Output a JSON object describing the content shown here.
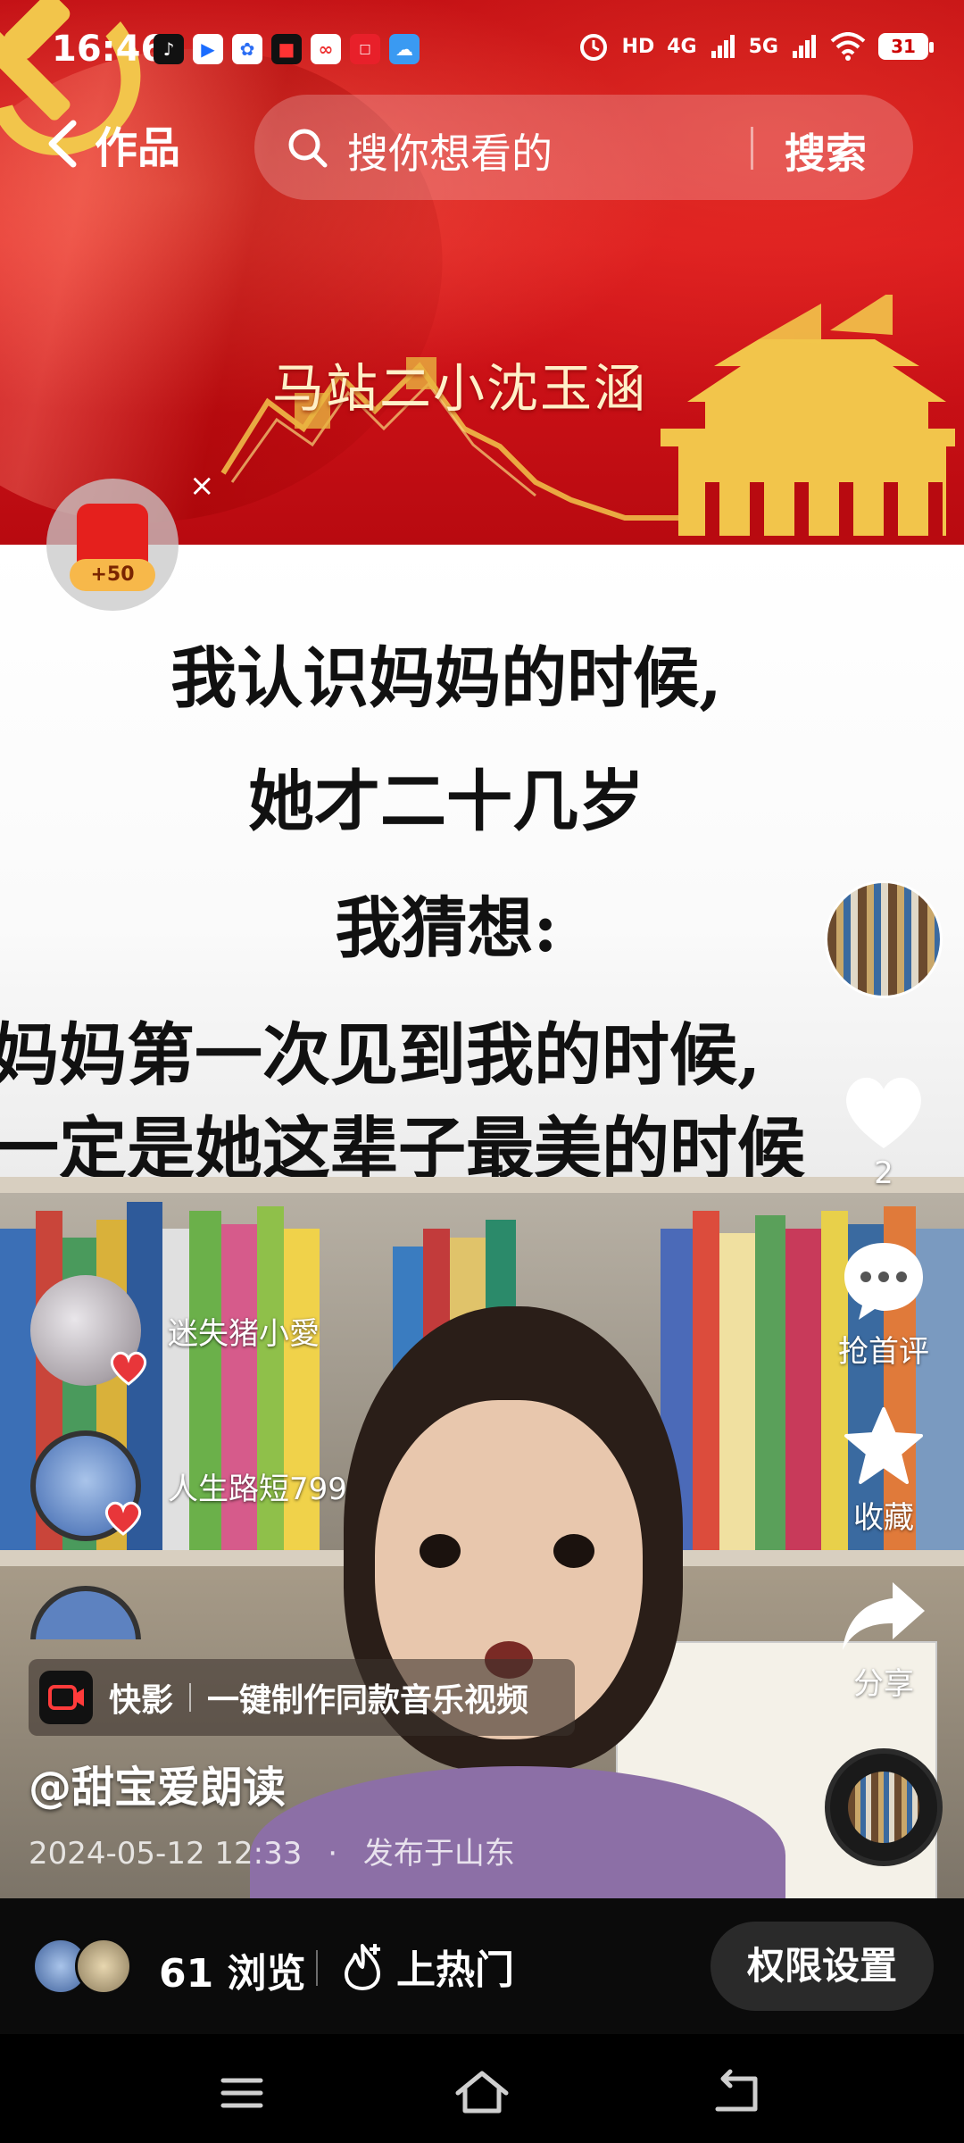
{
  "status_bar": {
    "time": "16:46",
    "network_labels": [
      "HD",
      "4G",
      "5G"
    ],
    "battery": "31"
  },
  "top_nav": {
    "back_label": "作品",
    "search_placeholder": "搜你想看的",
    "search_button": "搜索"
  },
  "banner": {
    "title": "马站二小沈玉涵"
  },
  "red_packet": {
    "reward": "+50",
    "close": "×"
  },
  "poem": {
    "lines": [
      "我认识妈妈的时候,",
      "她才二十几岁",
      "我猜想:",
      "妈妈第一次见到我的时候,",
      "一定是她这辈子最美的时候"
    ]
  },
  "viewers": [
    {
      "name": "迷失猪小愛"
    },
    {
      "name": "人生路短799"
    }
  ],
  "actions": {
    "like_count": "2",
    "comment_label": "抢首评",
    "favorite_label": "收藏",
    "share_label": "分享"
  },
  "template": {
    "app_name": "快影",
    "description": "一键制作同款音乐视频"
  },
  "post": {
    "author": "@甜宝爱朗读",
    "datetime": "2024-05-12 12:33",
    "location": "发布于山东",
    "separator": "·"
  },
  "bottom_bar": {
    "views": "61 浏览",
    "hot_label": "上热门",
    "permission_button": "权限设置"
  },
  "colors": {
    "banner_red": "#d8151b",
    "gold": "#f2c54b",
    "like_red": "#e8363a"
  }
}
